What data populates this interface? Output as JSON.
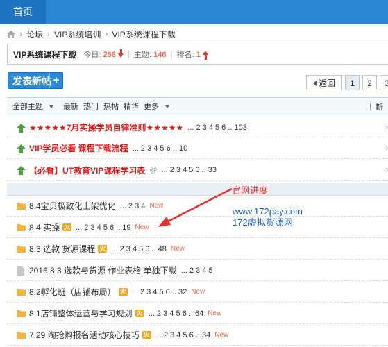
{
  "nav": {
    "home": "首页"
  },
  "breadcrumb": [
    "论坛",
    "VIP系统培训",
    "VIP系统课程下载"
  ],
  "forum": {
    "title": "VIP系统课程下载",
    "today_label": "今日:",
    "today_value": "268",
    "topics_label": "主题:",
    "topics_value": "146",
    "rank_label": "排名:",
    "rank_value": "1"
  },
  "post_button": "发表新帖",
  "pager": {
    "back": "返回",
    "pages": [
      "1",
      "2",
      "3"
    ]
  },
  "filters": {
    "all": "全部主题",
    "latest": "最新",
    "hot": "热门",
    "hotpost": "热帖",
    "digest": "精华",
    "more": "更多",
    "new_window": "新"
  },
  "sticky": [
    {
      "title": "★★★★★7月实操学员自律准则★★★★★",
      "pages": "... 2 3 4 5 6 .. 103"
    },
    {
      "title": "VIP学员必看 课程下载流程",
      "pages": "... 2 3 4 5 6 .. 10"
    },
    {
      "title": "【必看】UT教育VIP课程学习表",
      "pages": "... 2 3 4 5 6 .. 33",
      "attach": "@"
    }
  ],
  "threads": [
    {
      "title": "8.4宝贝极致化上架优化",
      "pages": "... 2 3 4",
      "new": "New",
      "hot": ""
    },
    {
      "title": "8.4 实操",
      "pages": "... 2 3 4 5 6 .. 19",
      "new": "New",
      "hot": "火"
    },
    {
      "title": "8.3 选款 货源课程",
      "pages": "... 2 3 4 5 6 .. 48",
      "new": "New",
      "hot": "火"
    },
    {
      "title": "2016 8.3 选款与货源 作业表格 单独下载",
      "pages": "... 2 3 4 5",
      "new": "",
      "hot": ""
    },
    {
      "title": "8.2孵化班（店铺布局）",
      "pages": "... 2 3 4 5 6 .. 32",
      "new": "New",
      "hot": "火"
    },
    {
      "title": "8.1店铺整体运营与学习规划",
      "pages": "... 2 3 4 5 6 .. 64",
      "new": "New",
      "hot": "火"
    },
    {
      "title": "7.29 淘抢购报名活动核心技巧",
      "pages": "... 2 3 4 5 6 .. 34",
      "new": "New",
      "hot": "火"
    }
  ],
  "annotations": {
    "progress": "官网进度",
    "url": "www.172pay.com",
    "site": "172虚拟货源网"
  },
  "colors": {
    "nav_bg": "#2b87d3",
    "accent_red": "#e01d1d",
    "new_orange": "#f26c4f"
  }
}
